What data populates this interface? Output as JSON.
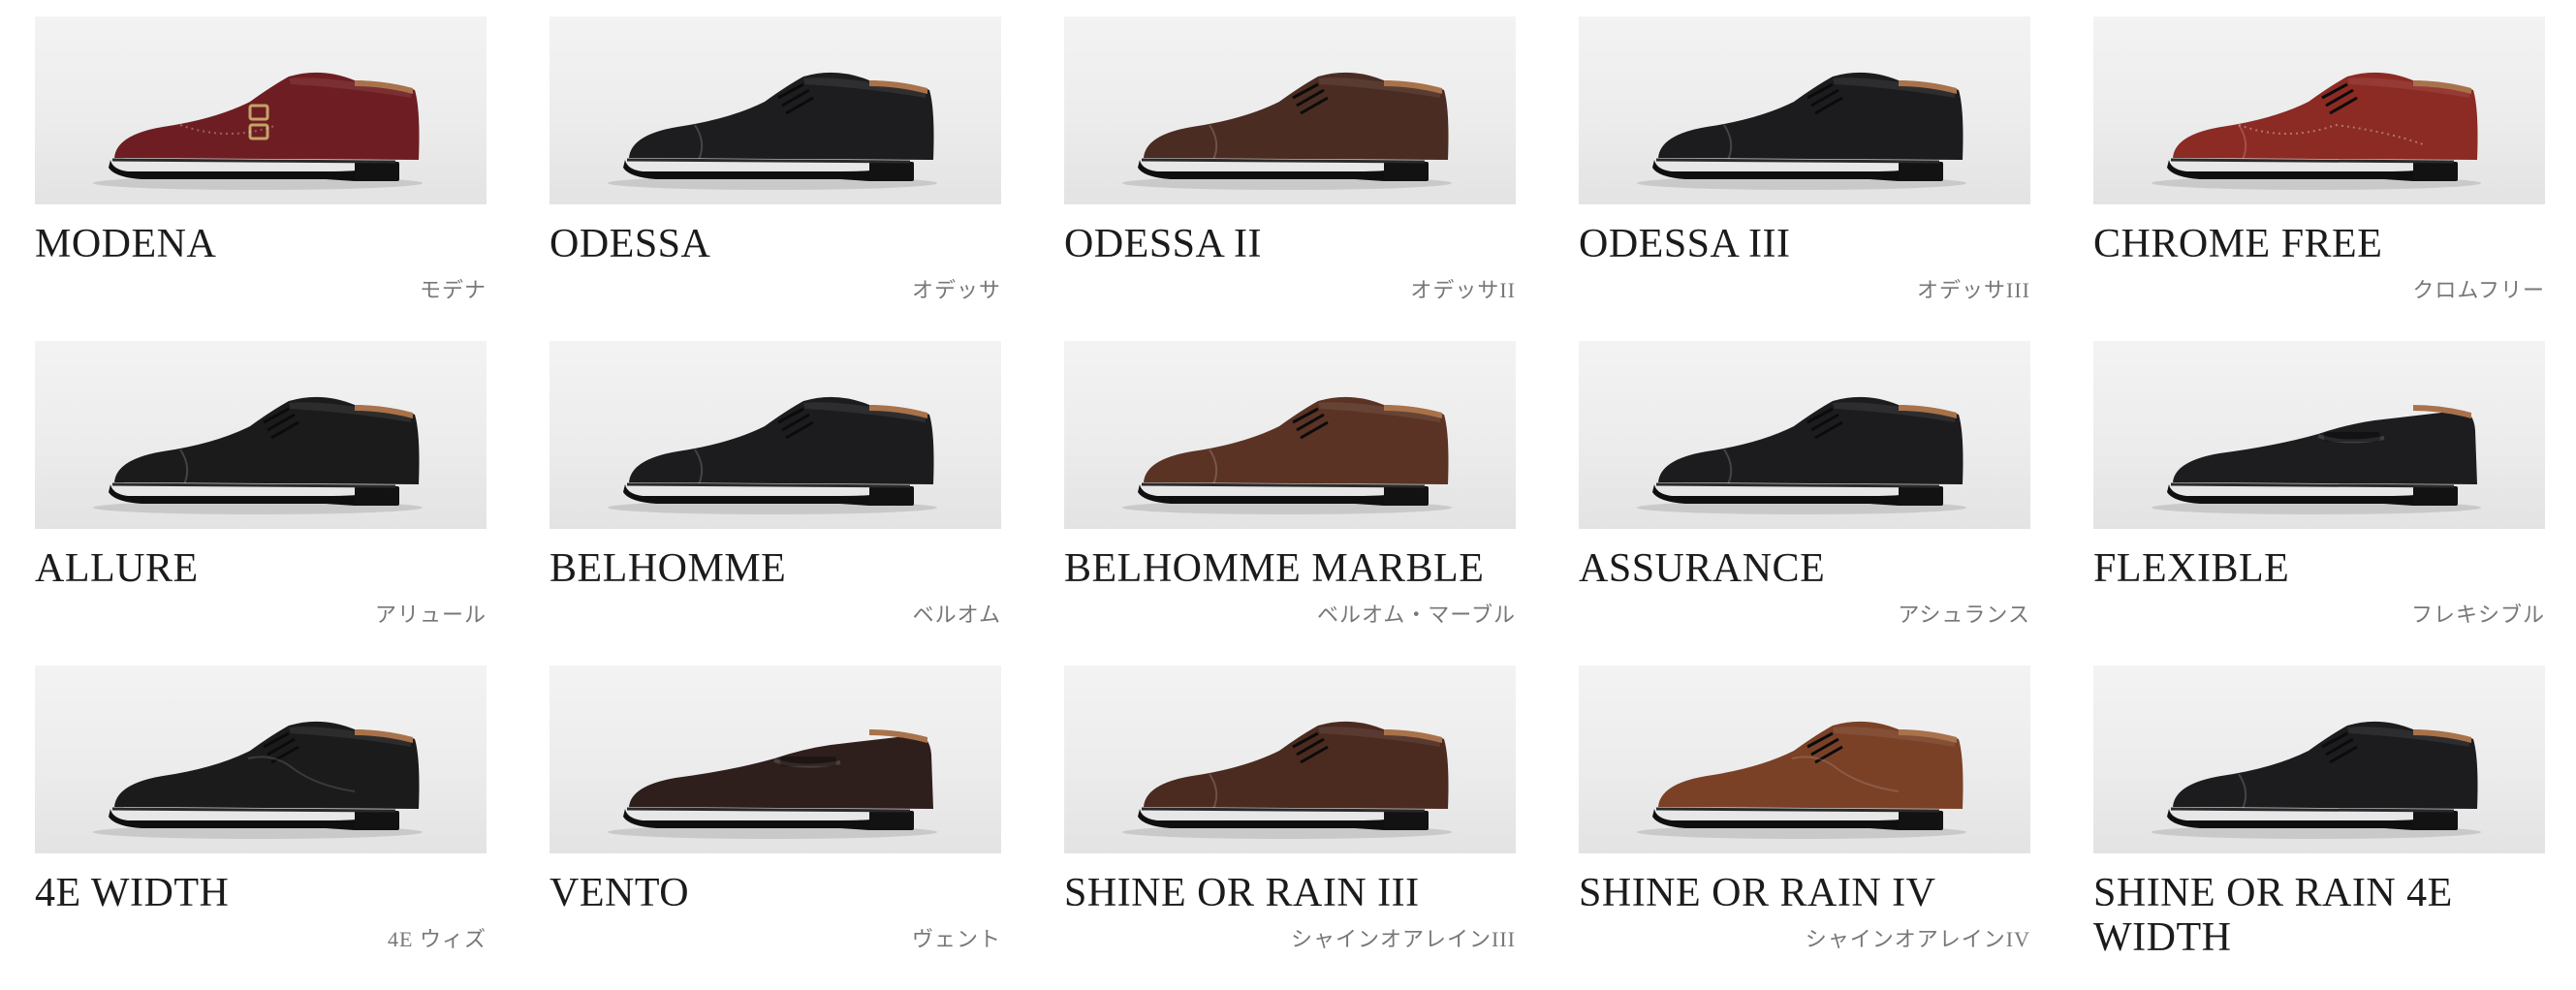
{
  "products": [
    {
      "name": "MODENA",
      "kana": "モデナ",
      "style": "monk",
      "upper": "#6e1e22",
      "accent": "#c4a468"
    },
    {
      "name": "ODESSA",
      "kana": "オデッサ",
      "style": "captoe",
      "upper": "#1d1d1f"
    },
    {
      "name": "ODESSA II",
      "kana": "オデッサII",
      "style": "captoe",
      "upper": "#4a2c22"
    },
    {
      "name": "ODESSA III",
      "kana": "オデッサIII",
      "style": "captoe",
      "upper": "#1c1c1e"
    },
    {
      "name": "CHROME FREE",
      "kana": "クロムフリー",
      "style": "wingtip",
      "upper": "#8c2a24"
    },
    {
      "name": "ALLURE",
      "kana": "アリュール",
      "style": "captoe",
      "upper": "#1b1b1c"
    },
    {
      "name": "BELHOMME",
      "kana": "ベルオム",
      "style": "captoe",
      "upper": "#1c1c1e"
    },
    {
      "name": "BELHOMME MARBLE",
      "kana": "ベルオム・マーブル",
      "style": "captoe",
      "upper": "#5a3324"
    },
    {
      "name": "ASSURANCE",
      "kana": "アシュランス",
      "style": "captoe",
      "upper": "#1c1c1e"
    },
    {
      "name": "FLEXIBLE",
      "kana": "フレキシブル",
      "style": "loafer",
      "upper": "#1d1d1f"
    },
    {
      "name": "4E WIDTH",
      "kana": "4E ウィズ",
      "style": "derby",
      "upper": "#1b1b1c"
    },
    {
      "name": "VENTO",
      "kana": "ヴェント",
      "style": "loafer",
      "upper": "#2e1f1c"
    },
    {
      "name": "SHINE OR RAIN III",
      "kana": "シャインオアレインIII",
      "style": "captoe",
      "upper": "#4b2a20"
    },
    {
      "name": "SHINE OR RAIN IV",
      "kana": "シャインオアレインIV",
      "style": "derby",
      "upper": "#7a4127"
    },
    {
      "name": "SHINE OR RAIN 4E WIDTH",
      "kana": "",
      "style": "captoe",
      "upper": "#1c1c1e"
    }
  ]
}
